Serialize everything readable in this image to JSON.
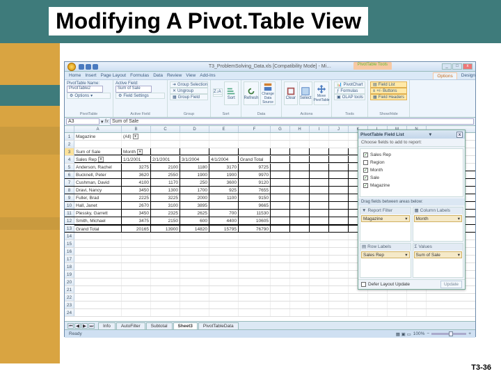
{
  "slide": {
    "title": "Modifying A Pivot.Table View",
    "footer": "T3-36"
  },
  "window": {
    "doc_title": "T3_ProblemSolving_Data.xls [Compatibility Mode] - Mi…",
    "pt_tools": "PivotTable Tools",
    "tabs": [
      "Home",
      "Insert",
      "Page Layout",
      "Formulas",
      "Data",
      "Review",
      "View",
      "Add-Ins"
    ],
    "context_tabs": [
      "Options",
      "Design"
    ],
    "ribbon": {
      "pt_name_label": "PivotTable Name:",
      "pt_name_value": "PivotTable2",
      "options_btn": "Options",
      "g_pivot": "PivotTable",
      "active_field_label": "Active Field:",
      "active_field_value": "Sum of Sale",
      "field_settings": "Field Settings",
      "g_active": "Active Field",
      "grp_sel": "Group Selection",
      "ungrp": "Ungroup",
      "grp_fld": "Group Field",
      "g_group": "Group",
      "sort_az": "A↓Z",
      "sort_za": "Z↓A",
      "sort": "Sort",
      "g_sort": "Sort",
      "refresh": "Refresh",
      "change_ds": "Change Data Source",
      "g_data": "Data",
      "clear": "Clear",
      "select": "Select",
      "move": "Move PivotTable",
      "g_actions": "Actions",
      "pchart": "PivotChart",
      "formulas": "Formulas",
      "olap": "OLAP tools",
      "g_tools": "Tools",
      "field_list": "Field List",
      "pm_buttons": "+/- Buttons",
      "field_headers": "Field Headers",
      "g_show": "Show/Hide"
    },
    "formula_bar": {
      "namebox": "A3",
      "fx_label": "fx",
      "value": "Sum of Sale"
    },
    "columns": [
      "A",
      "B",
      "C",
      "D",
      "E",
      "F",
      "G",
      "H",
      "I",
      "J",
      "K",
      "L",
      "M",
      "N"
    ],
    "pivot": {
      "page_field": "Magazine",
      "page_value": "(All)",
      "data_label": "Sum of Sale",
      "col_field": "Month",
      "row_field": "Sales Rep",
      "col_headers": [
        "1/1/2001",
        "2/1/2001",
        "3/1/2004",
        "4/1/2004",
        "Grand Total"
      ],
      "rows": [
        {
          "name": "Anderson, Rachel",
          "v": [
            3275,
            2100,
            1180,
            3170,
            9725
          ]
        },
        {
          "name": "Bucknell, Peter",
          "v": [
            3620,
            2550,
            1900,
            1900,
            9970
          ]
        },
        {
          "name": "Cushman, David",
          "v": [
            4100,
            1170,
            250,
            3600,
            9120
          ]
        },
        {
          "name": "Dravi, Nancy",
          "v": [
            3450,
            1300,
            1700,
            925,
            7655
          ]
        },
        {
          "name": "Fuller, Brad",
          "v": [
            2225,
            3225,
            2000,
            1100,
            9150
          ]
        },
        {
          "name": "Hall, Janet",
          "v": [
            2670,
            3100,
            3895,
            "",
            9665
          ]
        },
        {
          "name": "Plessky, Garrett",
          "v": [
            3450,
            2325,
            2625,
            700,
            11530
          ]
        },
        {
          "name": "Smith, Michael",
          "v": [
            3475,
            2150,
            600,
            4400,
            10605
          ]
        },
        {
          "name": "Grand Total",
          "v": [
            20165,
            13900,
            14820,
            15795,
            76790
          ]
        }
      ]
    },
    "field_list": {
      "title": "PivotTable Field List",
      "subtitle": "Choose fields to add to report:",
      "fields": [
        {
          "label": "Sales Rep",
          "checked": true
        },
        {
          "label": "Region",
          "checked": false
        },
        {
          "label": "Month",
          "checked": true
        },
        {
          "label": "Sale",
          "checked": true
        },
        {
          "label": "Magazine",
          "checked": true
        }
      ],
      "drag_label": "Drag fields between areas below:",
      "areas": {
        "report": {
          "label": "Report Filter",
          "item": "Magazine"
        },
        "columns": {
          "label": "Column Labels",
          "item": "Month"
        },
        "rows": {
          "label": "Row Labels",
          "item": "Sales Rep"
        },
        "values": {
          "label": "Values",
          "item": "Sum of Sale"
        }
      },
      "defer": "Defer Layout Update",
      "update": "Update"
    },
    "sheets": {
      "tabs": [
        "Info",
        "AutoFilter",
        "Subtotal",
        "Sheet3",
        "PivotTableData"
      ],
      "active": "Sheet3"
    },
    "status": {
      "ready": "Ready",
      "zoom": "100%"
    }
  }
}
